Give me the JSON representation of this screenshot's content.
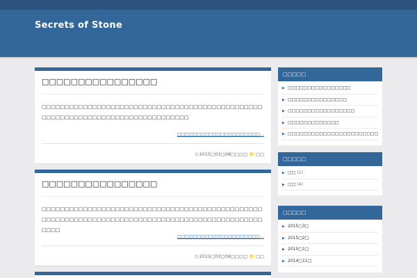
{
  "site": {
    "title": "Secrets of Stone"
  },
  "posts": [
    {
      "title": "□□□□□□□□□□□□□□□□",
      "excerpt": "□□□□□□□□□□□□□□□□□□□□□□□□□□□□□□□□□□□□□□□□□□□□□□□□□□□□□□□□□□□□□□□□□□□□□□□□□□□□□□□□",
      "more": "□□□□□□□□□□□□□□□□□□□□□…",
      "date": "2015□03□08□□□□",
      "category": "□□"
    },
    {
      "title": "□□□□□□□□□□□□□□□□",
      "excerpt": "□□□□□□□□□□□□□□□□□□□□□□□□□□□□□□□□□□□□□□□□□□□□□□□□□□□□□□□□□□□□□□□□□□□□□□□□□□□□□□□□□□□□□□□□□□□□□□□□□□□□",
      "more": "□□□□□□□□□□□□□□□□□□□□□…",
      "date": "2015□03□08□□□□",
      "category": "□□"
    }
  ],
  "sidebar": {
    "recent": {
      "title": "□□□□□",
      "items": [
        "□□□□□□□□□□□□□□□□",
        "□□□□□□□□□□□□□□□",
        "□□□□□□□□□□□□□□□□□",
        "□□□□□□□□□□□□□",
        "□□□□□□□□□□□□□□□□□□□□□□□□□"
      ]
    },
    "categories": {
      "title": "□□□□□",
      "items": [
        {
          "label": "□□",
          "count": "(1)"
        },
        {
          "label": "□□",
          "count": "(4)"
        }
      ]
    },
    "archives": {
      "title": "□□□□□",
      "items": [
        "2015□3□",
        "2015□2□",
        "2015□1□",
        "2014□11□"
      ]
    }
  },
  "icons": {
    "clock": "clock-icon",
    "folder": "folder-icon",
    "bullet": "triangle-right-icon"
  },
  "colors": {
    "accent": "#336699",
    "header_top": "#2b527a",
    "background": "#ebebed",
    "link": "#1a5fa8"
  }
}
